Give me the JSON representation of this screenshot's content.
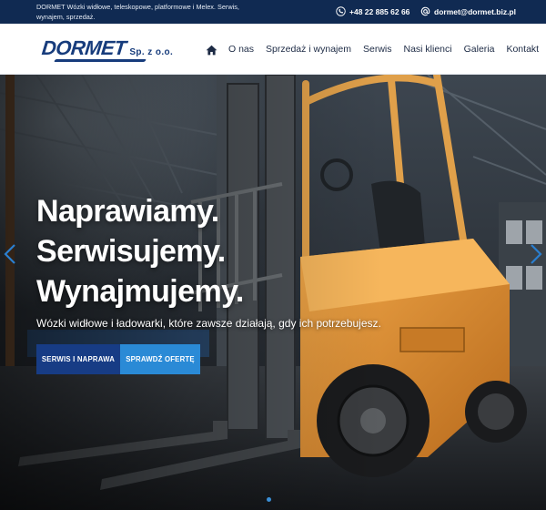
{
  "topbar": {
    "tagline": "DORMET Wózki widłowe, teleskopowe, platformowe i Melex. Serwis, wynajem, sprzedaż.",
    "phone": "+48 22 885 62 66",
    "email": "dormet@dormet.biz.pl",
    "phone_icon": "phone-icon",
    "email_icon": "at-sign-icon"
  },
  "header": {
    "logo_text": "DORMET",
    "logo_suffix": "Sp. z o.o.",
    "home_icon": "home-icon",
    "nav": [
      "O nas",
      "Sprzedaż i wynajem",
      "Serwis",
      "Nasi klienci",
      "Galeria",
      "Kontakt"
    ]
  },
  "hero": {
    "headline": [
      "Naprawiamy.",
      "Serwisujemy.",
      "Wynajmujemy."
    ],
    "subtitle": "Wózki widłowe i ładowarki, które zawsze działają, gdy ich potrzebujesz.",
    "primary_button": "Serwis i naprawa",
    "secondary_button": "Sprawdź ofertę",
    "prev_icon": "chevron-left-icon",
    "next_icon": "chevron-right-icon"
  },
  "colors": {
    "topbar_bg": "#102a52",
    "brand_blue": "#173c7c",
    "primary_button": "#173c85",
    "secondary_button": "#2a8ad6",
    "forklift_orange": "#e8962c"
  }
}
